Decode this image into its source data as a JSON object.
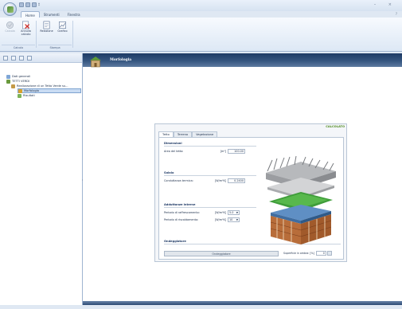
{
  "app": {
    "qat_mark": "‡",
    "window_controls": "– ×",
    "help_mark": "?"
  },
  "ribbon": {
    "tabs": [
      {
        "label": "Home"
      },
      {
        "label": "Strumenti"
      },
      {
        "label": "Finestra"
      }
    ],
    "groups": [
      {
        "label": "Calcolo",
        "buttons": [
          {
            "label": "Calcola",
            "icon": "calc-icon"
          },
          {
            "label": "Annulla calcolo",
            "icon": "cancel-calc-icon"
          }
        ]
      },
      {
        "label": "Stampa",
        "buttons": [
          {
            "label": "Relazione",
            "icon": "report-icon"
          },
          {
            "label": "Grafico",
            "icon": "chart-icon"
          }
        ]
      }
    ]
  },
  "tree": {
    "items": [
      {
        "label": "Dati generali"
      },
      {
        "label": "TETTI VERDI"
      },
      {
        "label": "Realizzazione di un Tetto Verde su..."
      },
      {
        "label": "Morfologia"
      },
      {
        "label": "Risultati"
      }
    ]
  },
  "main": {
    "title": "Morfologia",
    "status": "CALCOLATO",
    "tabs": [
      {
        "label": "Tetto"
      },
      {
        "label": "Terreno"
      },
      {
        "label": "Vegetazione"
      }
    ],
    "sections": {
      "dimensioni": "Dimensioni",
      "solaio": "Solaio",
      "adduttanze": "Adduttanze interne",
      "ondeggiatore": "Ondeggiatore"
    },
    "area": {
      "label": "Area del tetto:",
      "unit": "[m²]",
      "value": "100.00"
    },
    "conduttanza": {
      "label": "Conduttanza termica:",
      "unit": "[W/m²K]",
      "value": "0.2400"
    },
    "raffrescamento": {
      "label": "Periodo di raffrescamento:",
      "unit": "[W/m²K]",
      "value": "5.0"
    },
    "riscaldamento": {
      "label": "Periodo di riscaldamento:",
      "unit": "[W/m²K]",
      "value": "10"
    },
    "ond_button": "Ondeggiatore",
    "superficie": {
      "label": "Superficie in ombra: [%]",
      "value": "0"
    }
  }
}
